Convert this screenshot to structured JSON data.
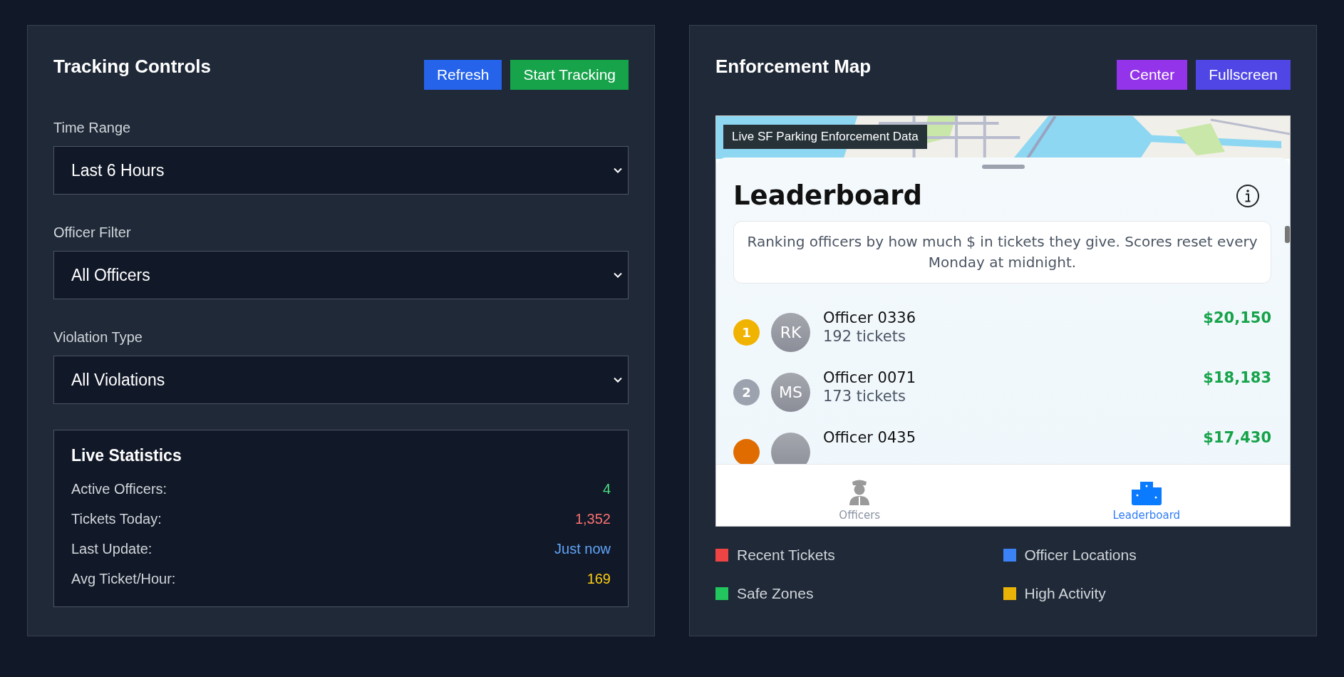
{
  "controls": {
    "title": "Tracking Controls",
    "buttons": [
      {
        "label": "Refresh",
        "kind": "primary"
      },
      {
        "label": "Start Tracking",
        "kind": "success"
      }
    ],
    "filters": [
      {
        "label": "Time Range",
        "value": "Last 6 Hours"
      },
      {
        "label": "Officer Filter",
        "value": "All Officers"
      },
      {
        "label": "Violation Type",
        "value": "All Violations"
      }
    ],
    "stats": {
      "title": "Live Statistics",
      "items": [
        {
          "label": "Active Officers:",
          "value": "4",
          "color": "#4ade80"
        },
        {
          "label": "Tickets Today:",
          "value": "1,352",
          "color": "#f87171"
        },
        {
          "label": "Last Update:",
          "value": "Just now",
          "color": "#60a5fa"
        },
        {
          "label": "Avg Ticket/Hour:",
          "value": "169",
          "color": "#facc15"
        }
      ]
    }
  },
  "map": {
    "title": "Enforcement Map",
    "buttons": [
      {
        "label": "Center",
        "kind": "purple"
      },
      {
        "label": "Fullscreen",
        "kind": "indigo"
      }
    ],
    "overlay_label": "Live SF Parking Enforcement Data",
    "leaderboard": {
      "title": "Leaderboard",
      "description": "Ranking officers by how much $ in tickets they give. Scores reset every Monday at midnight.",
      "rows": [
        {
          "rank": "1",
          "color": "#f0b400",
          "initials": "RK",
          "name": "Officer 0336",
          "tickets": "192 tickets",
          "amount": "$20,150"
        },
        {
          "rank": "2",
          "color": "#9ca3af",
          "initials": "MS",
          "name": "Officer 0071",
          "tickets": "173 tickets",
          "amount": "$18,183"
        },
        {
          "color": "#e06c00",
          "name": "Officer 0435",
          "amount": "$17,430"
        }
      ],
      "tabs": [
        {
          "label": "Officers",
          "kind": "officers",
          "selected": false
        },
        {
          "label": "Leaderboard",
          "kind": "podium",
          "selected": true
        }
      ]
    },
    "legend": [
      {
        "label": "Recent Tickets",
        "color": "#ef4444"
      },
      {
        "label": "Officer Locations",
        "color": "#3b82f6"
      },
      {
        "label": "Safe Zones",
        "color": "#22c55e"
      },
      {
        "label": "High Activity",
        "color": "#eab308"
      }
    ]
  }
}
